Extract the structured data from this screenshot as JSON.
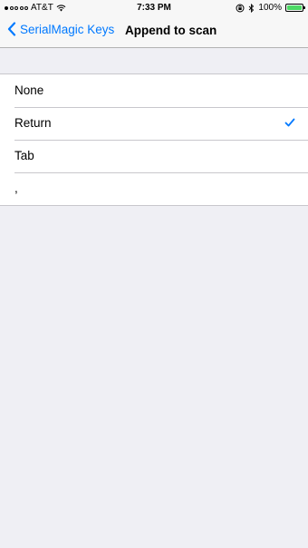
{
  "status_bar": {
    "carrier": "AT&T",
    "time": "7:33 PM",
    "battery": "100%",
    "signal_bars_filled": 1,
    "signal_bars_total": 5,
    "icons": [
      "wifi-icon",
      "orientation-lock-icon",
      "bluetooth-icon",
      "battery-icon"
    ]
  },
  "nav": {
    "back_label": "SerialMagic Keys",
    "title": "Append to scan"
  },
  "options": [
    {
      "label": "None",
      "selected": false
    },
    {
      "label": "Return",
      "selected": true
    },
    {
      "label": "Tab",
      "selected": false
    },
    {
      "label": ",",
      "selected": false
    }
  ],
  "colors": {
    "accent": "#0079ff",
    "background": "#efeff4",
    "battery": "#4cd964"
  }
}
